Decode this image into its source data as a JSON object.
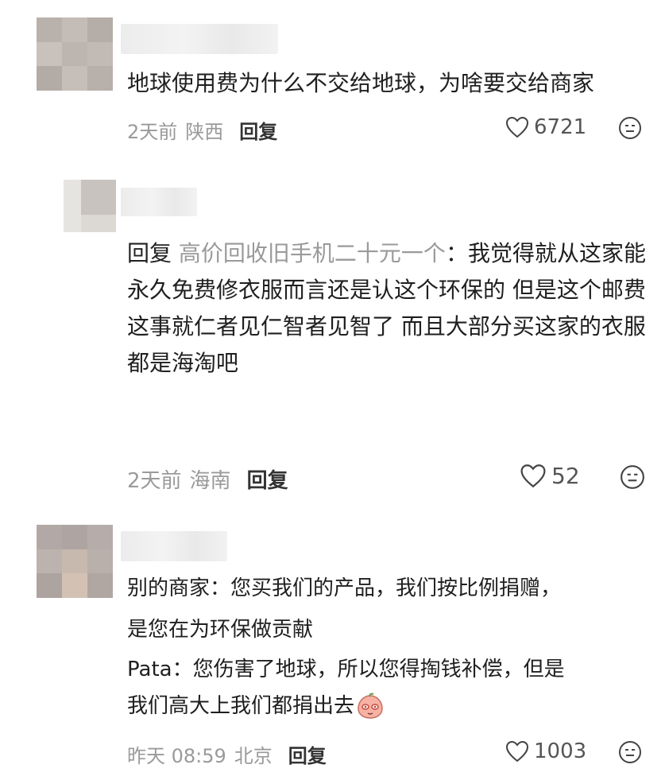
{
  "comments": [
    {
      "text": "地球使用费为什么不交给地球，为啥要交给商家",
      "time": "2天前",
      "location": "陕西",
      "reply_label": "回复",
      "likes": "6721"
    },
    {
      "reply_prefix": "回复",
      "reply_target": "高价回收旧手机二十元一个",
      "text": "：我觉得就从这家能永久免费修衣服而言还是认这个环保的 但是这个邮费这事就仁者见仁智者见智了 而且大部分买这家的衣服都是海淘吧",
      "time": "2天前",
      "location": "海南",
      "reply_label": "回复",
      "likes": "52"
    },
    {
      "line1": "别的商家：您买我们的产品，我们按比例捐赠，",
      "line2": "是您在为环保做贡献",
      "line3": "Pata：您伤害了地球，所以您得掏钱补偿，但是",
      "line4": "我们高大上我们都捐出去",
      "time": "昨天 08:59",
      "location": "北京",
      "reply_label": "回复",
      "likes": "1003"
    }
  ],
  "icons": {
    "like": "heart-outline-icon",
    "emoji": "emoji-face-icon",
    "inline_emoji": "peach-face-emoji"
  },
  "colors": {
    "text": "#1f1f1f",
    "meta": "#9a9a9a",
    "reply_target": "#9a9a9a"
  }
}
